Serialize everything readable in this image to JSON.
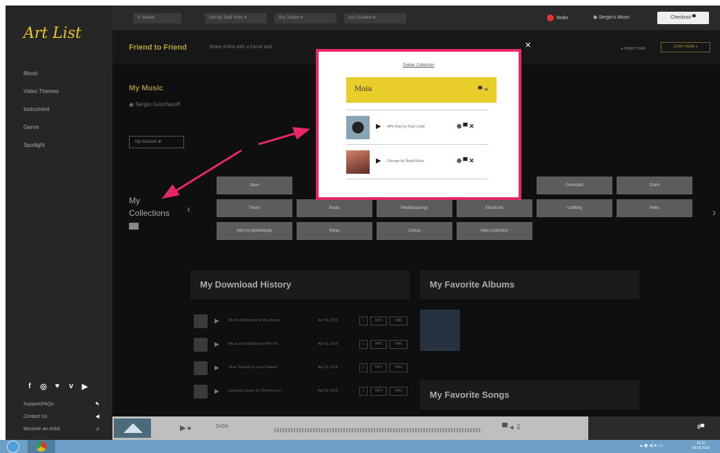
{
  "sidebar": {
    "logo": "Art List",
    "nav": [
      "Mood",
      "Video Themes",
      "Instrument",
      "Genre",
      "Spotlight"
    ],
    "social_icons": [
      "facebook-icon",
      "instagram-icon",
      "twitter-icon",
      "vimeo-icon",
      "youtube-icon"
    ],
    "social_glyphs": [
      "f",
      "◎",
      "♥",
      "v",
      "▶"
    ],
    "footer_links": [
      {
        "label": "Support/FAQs",
        "icon": "wrench-icon",
        "glyph": "✎"
      },
      {
        "label": "Contact Us",
        "icon": "send-icon",
        "glyph": "◀"
      },
      {
        "label": "Become an Artist",
        "icon": "music-icon",
        "glyph": "♫"
      }
    ]
  },
  "topbar": {
    "search_placeholder": "Search",
    "sort": "Sort By Staff Picks",
    "tempo": "Any Tempo",
    "duration": "Any Duration",
    "refer": "Refer",
    "user": "Sergio's Music",
    "checkout": "Checkout"
  },
  "banner": {
    "title": "Friend to Friend",
    "text": "Share Artlist with a friend and",
    "video_tour": "VIDEO TOUR",
    "start_here": "START HERE"
  },
  "profile": {
    "heading": "My Music",
    "name": "Sergio Goncharoff",
    "account_button": "My Account"
  },
  "collections": {
    "heading_1": "My",
    "heading_2": "Collections",
    "tiles": [
      {
        "label": "Save",
        "row": 0,
        "col": 0
      },
      {
        "label": "Cinematic",
        "row": 0,
        "col": 4
      },
      {
        "label": "Dram",
        "row": 0,
        "col": 5
      },
      {
        "label": "Trevor",
        "row": 1,
        "col": 0
      },
      {
        "label": "Boots",
        "row": 1,
        "col": 1
      },
      {
        "label": "Weddingsongs",
        "row": 1,
        "col": 2
      },
      {
        "label": "Electronic",
        "row": 1,
        "col": 3
      },
      {
        "label": "Uplifting",
        "row": 1,
        "col": 4
      },
      {
        "label": "Hello",
        "row": 1,
        "col": 5
      },
      {
        "label": "Intro to Aprendizaje",
        "row": 2,
        "col": 0
      },
      {
        "label": "Relax",
        "row": 2,
        "col": 1
      },
      {
        "label": "Cortos",
        "row": 2,
        "col": 2
      },
      {
        "label": "New Collection",
        "row": 2,
        "col": 3
      }
    ]
  },
  "download_history": {
    "heading": "My Download History",
    "rows": [
      {
        "name": "We Are Billionaires by Max Beere...",
        "date": "Apr 09, 2018",
        "formats": [
          "L",
          "MP3",
          "WAV"
        ]
      },
      {
        "name": "We Just Got Started by When M...",
        "date": "Apr 09, 2018",
        "formats": [
          "L",
          "MP3",
          "WAV"
        ]
      },
      {
        "name": "Other Towards by Lena Hualand",
        "date": "Apr 09, 2018",
        "formats": [
          "L",
          "MP3",
          "WAV"
        ]
      },
      {
        "name": "Unnatural Career by The Freven C...",
        "date": "Apr 09, 2018",
        "formats": [
          "L",
          "MP3",
          "WAV"
        ]
      }
    ]
  },
  "favorites": {
    "albums_heading": "My Favorite Albums",
    "songs_heading": "My Favorite Songs"
  },
  "player": {
    "song": "DuDa",
    "count": "0"
  },
  "modal": {
    "delete_link": "Delete Collection",
    "collection_name": "Moia",
    "tracks": [
      {
        "name": "40% Rain by Shari Loyfe",
        "art_color": "#8aa3b5"
      },
      {
        "name": "Chicago by Distyll Music",
        "art_color": "#b0614a"
      }
    ]
  },
  "taskbar": {
    "chrome_label": "Chrome",
    "time": "15:23",
    "date": "09.05.2018"
  },
  "colors": {
    "accent": "#e9cd2a",
    "highlight": "#e6286b"
  }
}
